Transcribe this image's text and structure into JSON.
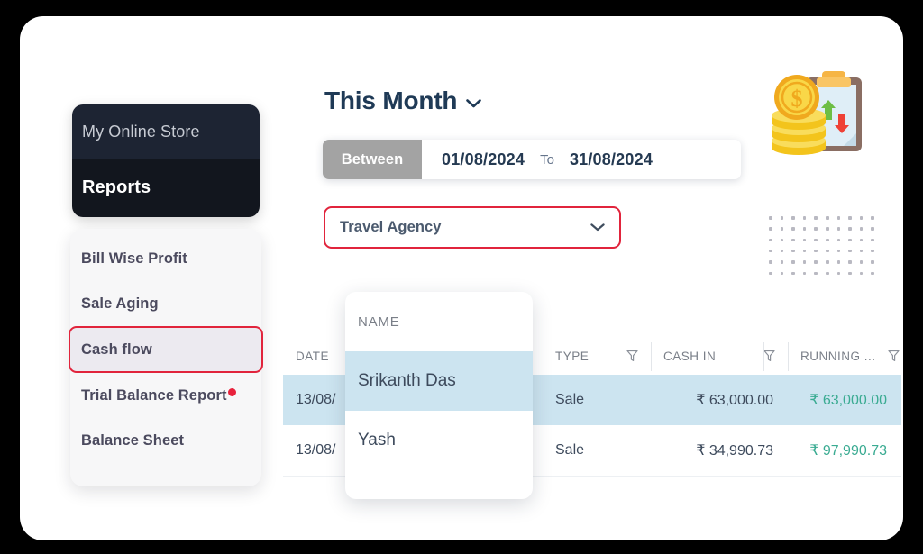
{
  "store": {
    "name": "My Online Store",
    "section": "Reports"
  },
  "menu": {
    "items": [
      {
        "label": "Bill Wise Profit",
        "active": false,
        "dot": false
      },
      {
        "label": "Sale Aging",
        "active": false,
        "dot": false
      },
      {
        "label": "Cash flow",
        "active": true,
        "dot": false
      },
      {
        "label": "Trial Balance Report",
        "active": false,
        "dot": true
      },
      {
        "label": "Balance Sheet",
        "active": false,
        "dot": false
      }
    ]
  },
  "header": {
    "period_label": "This Month",
    "chevron_icon": "chevron-down-icon"
  },
  "date_range": {
    "mode_label": "Between",
    "from": "01/08/2024",
    "to_label": "To",
    "to": "31/08/2024"
  },
  "agency_select": {
    "value": "Travel Agency",
    "chevron_icon": "chevron-down-icon"
  },
  "illustration": {
    "name": "financial-report-clipboard-coins-illustration"
  },
  "decoration": {
    "name": "dot-grid-pattern",
    "columns": 10,
    "rows": 6
  },
  "table": {
    "columns": [
      {
        "key": "date",
        "label": "DATE",
        "filter": false
      },
      {
        "key": "name",
        "label": "NAME",
        "filter": false
      },
      {
        "key": "type",
        "label": "TYPE",
        "filter": true
      },
      {
        "key": "cashin",
        "label": "CASH IN",
        "filter": true
      },
      {
        "key": "run",
        "label": "RUNNING ...",
        "filter": true
      }
    ],
    "rows": [
      {
        "date": "13/08/",
        "name": "Srikanth Das",
        "type": "Sale",
        "cashin": "₹ 63,000.00",
        "run": "₹ 63,000.00",
        "highlighted": true
      },
      {
        "date": "13/08/",
        "name": "Yash",
        "type": "Sale",
        "cashin": "₹ 34,990.73",
        "run": "₹ 97,990.73",
        "highlighted": false
      }
    ]
  },
  "name_popup": {
    "header": "NAME",
    "options": [
      {
        "label": "Srikanth Das",
        "highlighted": true
      },
      {
        "label": "Yash",
        "highlighted": false
      }
    ]
  },
  "colors": {
    "accent_red": "#e1243c",
    "sidebar_dark": "#1d2433",
    "sidebar_darker": "#12161e",
    "row_highlight": "#cce4f0",
    "running_total_green": "#3aab92",
    "between_gray": "#a3a3a3"
  }
}
